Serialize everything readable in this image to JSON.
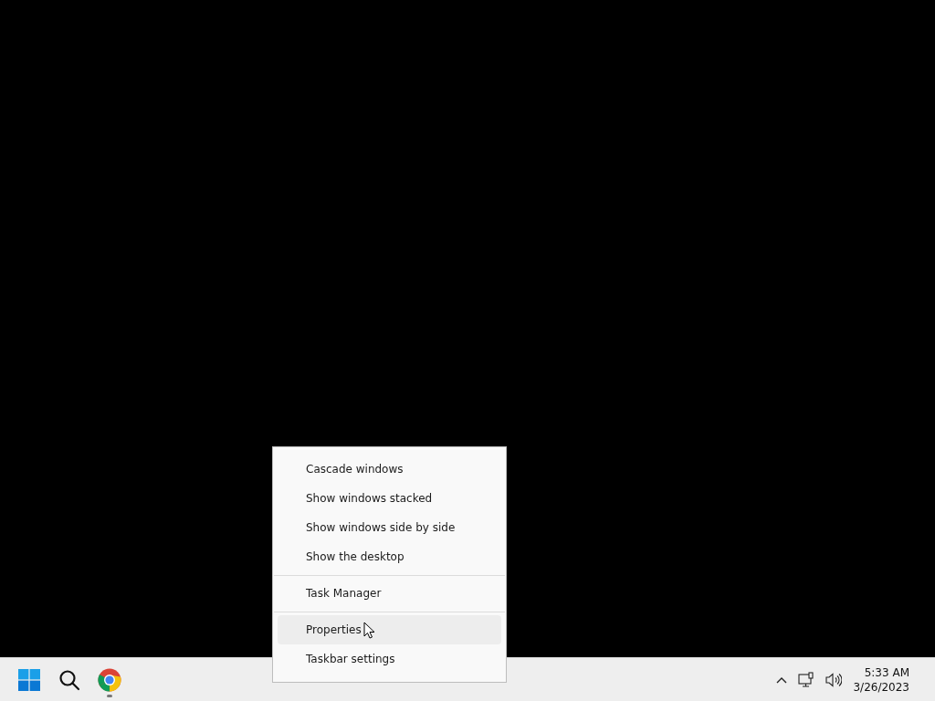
{
  "context_menu": {
    "items": [
      {
        "kind": "item",
        "label": "Cascade windows",
        "selected": false
      },
      {
        "kind": "item",
        "label": "Show windows stacked",
        "selected": false
      },
      {
        "kind": "item",
        "label": "Show windows side by side",
        "selected": false
      },
      {
        "kind": "item",
        "label": "Show the desktop",
        "selected": false
      },
      {
        "kind": "separator"
      },
      {
        "kind": "item",
        "label": "Task Manager",
        "selected": false
      },
      {
        "kind": "separator"
      },
      {
        "kind": "item",
        "label": "Properties",
        "selected": true
      },
      {
        "kind": "item",
        "label": "Taskbar settings",
        "selected": false
      }
    ]
  },
  "taskbar": {
    "apps": [
      {
        "kind": "start",
        "running": false
      },
      {
        "kind": "search",
        "running": false
      },
      {
        "kind": "browser",
        "running": true
      }
    ],
    "tray": {
      "icons": [
        {
          "kind": "chevron"
        },
        {
          "kind": "network"
        },
        {
          "kind": "volume"
        }
      ]
    },
    "clock": {
      "time": "5:33 AM",
      "date": "3/26/2023"
    }
  }
}
